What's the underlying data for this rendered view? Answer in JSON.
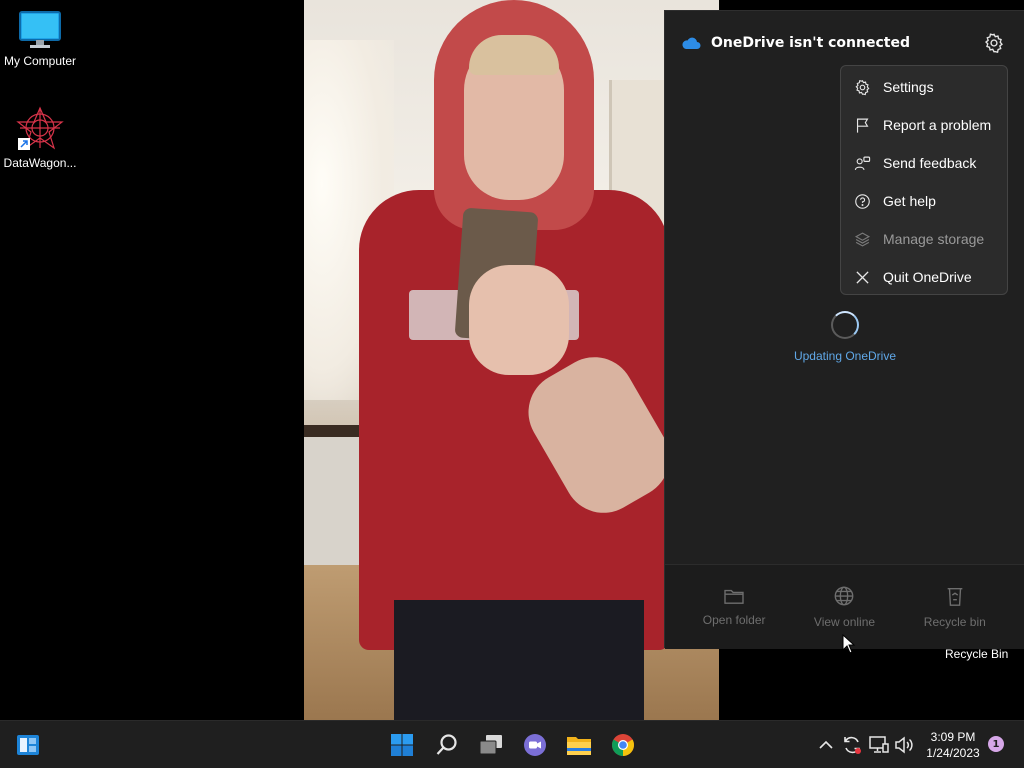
{
  "desktop": {
    "icons": [
      {
        "label": "My Computer",
        "icon": "monitor-icon"
      },
      {
        "label": "DataWagon...",
        "icon": "datawagon-logo-icon"
      }
    ],
    "recycle_bin_label": "Recycle Bin"
  },
  "onedrive": {
    "title": "OneDrive isn't connected",
    "menu": [
      {
        "label": "Settings",
        "icon": "gear-icon",
        "enabled": true
      },
      {
        "label": "Report a problem",
        "icon": "flag-icon",
        "enabled": true
      },
      {
        "label": "Send feedback",
        "icon": "feedback-icon",
        "enabled": true
      },
      {
        "label": "Get help",
        "icon": "help-icon",
        "enabled": true
      },
      {
        "label": "Manage storage",
        "icon": "storage-icon",
        "enabled": false
      },
      {
        "label": "Quit OneDrive",
        "icon": "close-icon",
        "enabled": true
      }
    ],
    "status": "Updating OneDrive",
    "footer": [
      {
        "label": "Open folder",
        "icon": "folder-icon"
      },
      {
        "label": "View online",
        "icon": "globe-icon"
      },
      {
        "label": "Recycle bin",
        "icon": "trash-icon"
      }
    ]
  },
  "taskbar": {
    "time": "3:09 PM",
    "date": "1/24/2023",
    "notification_count": "1",
    "apps": [
      "widgets-icon",
      "start-icon",
      "search-icon",
      "task-view-icon",
      "teams-chat-icon",
      "file-explorer-icon",
      "chrome-icon"
    ],
    "tray": [
      "chevron-up-icon",
      "onedrive-sync-icon",
      "network-icon",
      "volume-icon"
    ]
  },
  "colors": {
    "flyout_bg": "#202020",
    "accent_blue": "#60a8e8",
    "onedrive_blue": "#2d8ce6"
  }
}
